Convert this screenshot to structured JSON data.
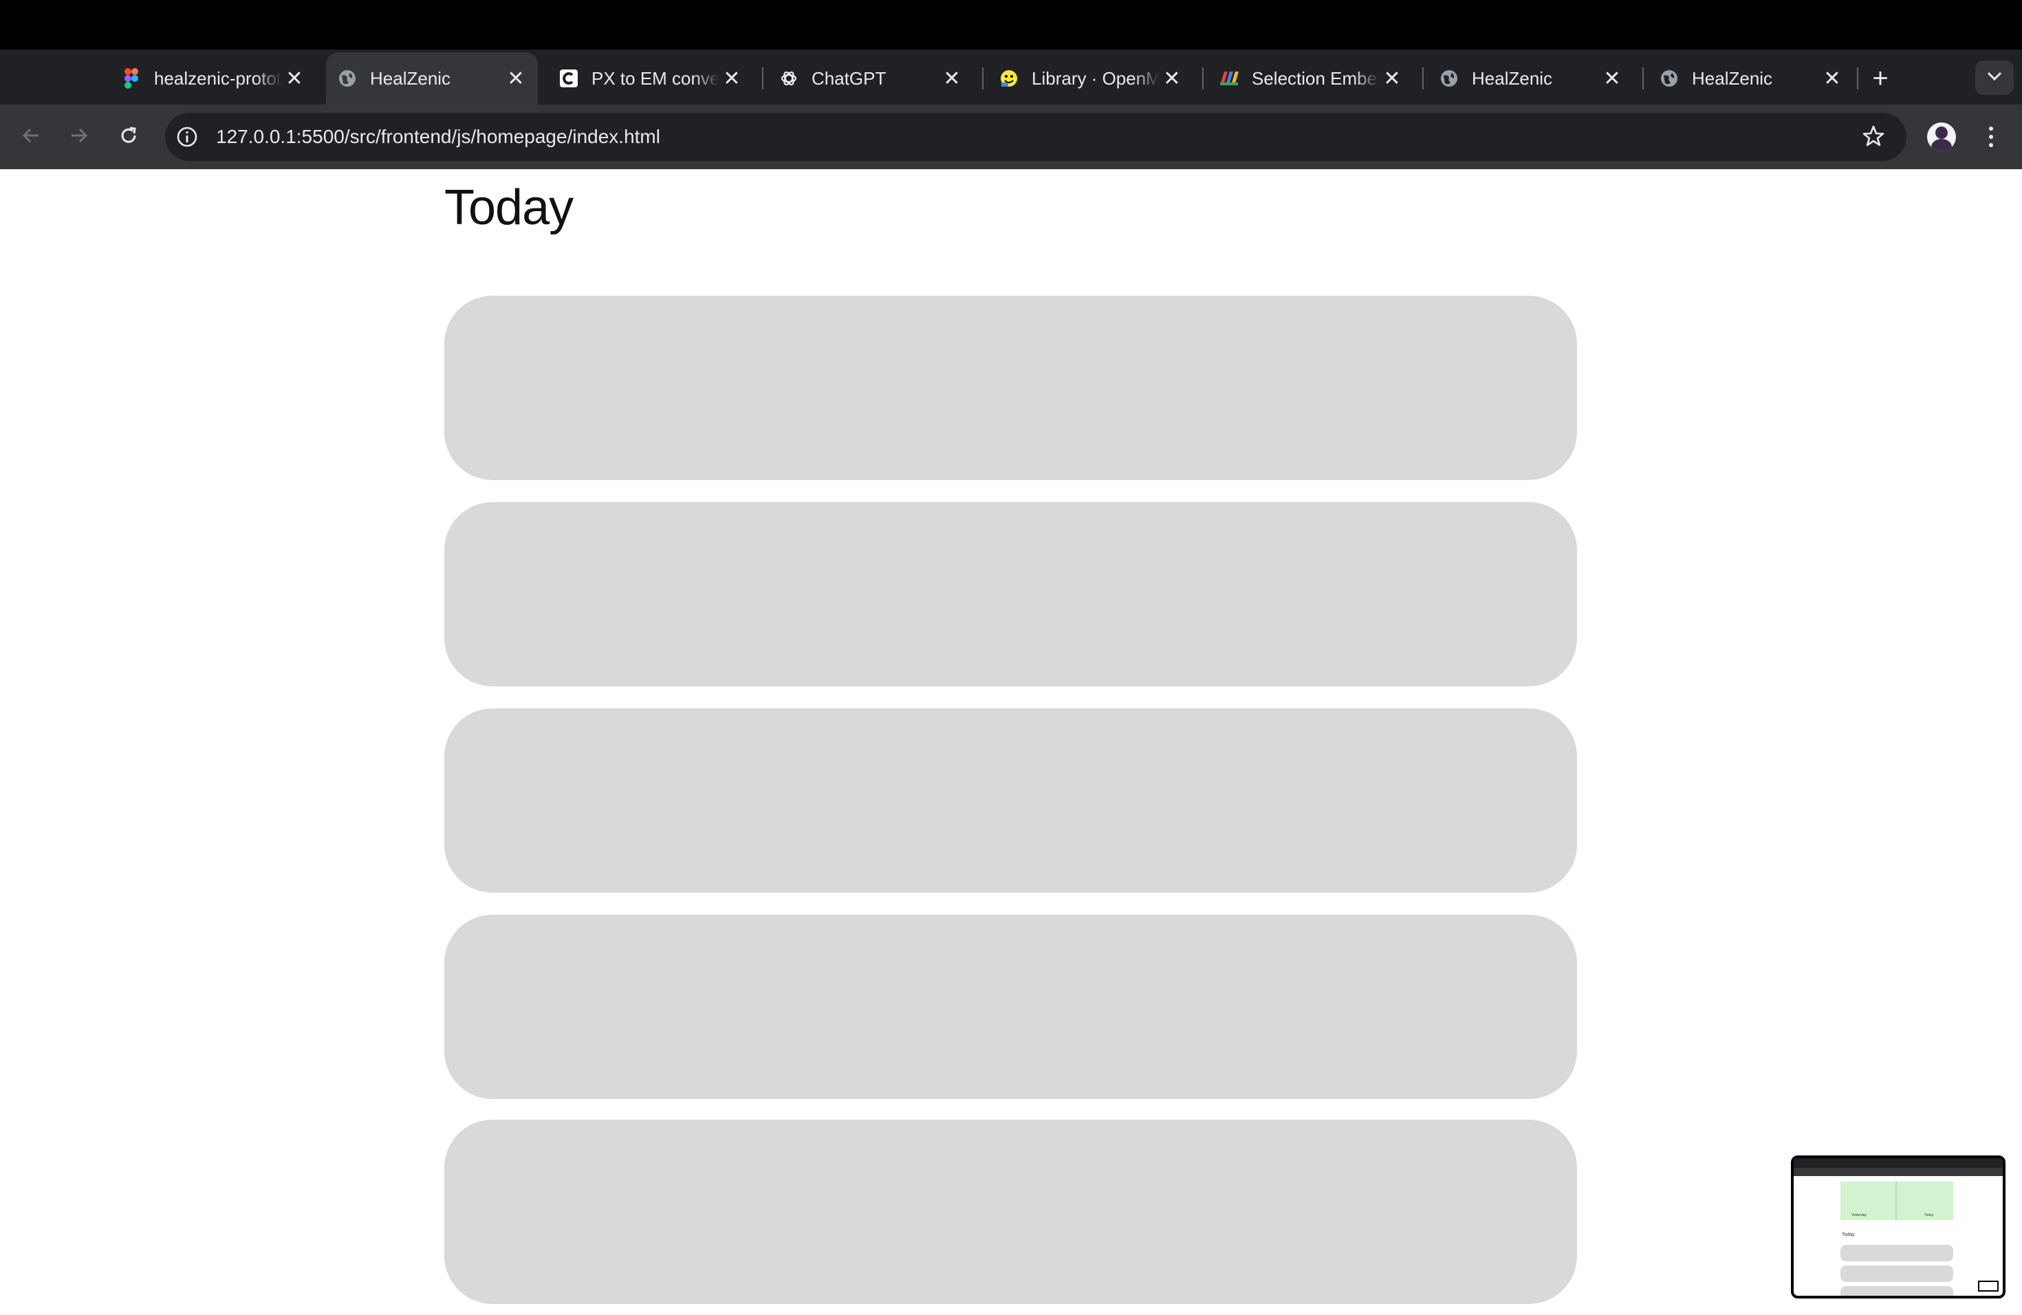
{
  "browser": {
    "tabs": [
      {
        "title": "healzenic-prototype",
        "favicon": "figma-icon",
        "active": false
      },
      {
        "title": "HealZenic",
        "favicon": "globe-icon",
        "active": true
      },
      {
        "title": "PX to EM converter",
        "favicon": "c-logo-icon",
        "active": false
      },
      {
        "title": "ChatGPT",
        "favicon": "openai-icon",
        "active": false
      },
      {
        "title": "Library · OpenMoji",
        "favicon": "openmoji-icon",
        "active": false
      },
      {
        "title": "Selection Embedding",
        "favicon": "multicolor-logo-icon",
        "active": false
      },
      {
        "title": "HealZenic",
        "favicon": "globe-icon",
        "active": false
      },
      {
        "title": "HealZenic",
        "favicon": "globe-icon",
        "active": false
      }
    ],
    "close_glyph": "✕",
    "new_tab_glyph": "+",
    "url": "127.0.0.1:5500/src/frontend/js/homepage/index.html",
    "colors": {
      "tabstrip": "#202124",
      "active_tab": "#35363a",
      "omnibox": "#202124",
      "text": "#e8eaed"
    }
  },
  "page": {
    "title": "Today",
    "cards": [
      {},
      {},
      {},
      {},
      {}
    ],
    "card_color": "#d9d9d9"
  },
  "preview": {
    "title": "Today",
    "left_label": "Yesterday",
    "right_label": "Today"
  }
}
